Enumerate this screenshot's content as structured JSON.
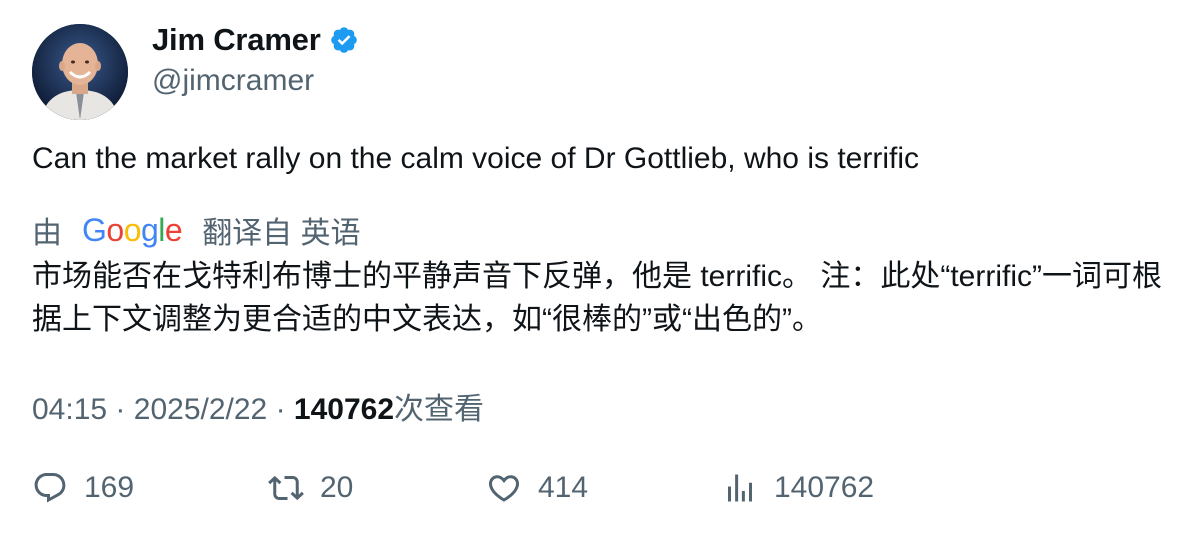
{
  "author": {
    "display_name": "Jim Cramer",
    "handle": "@jimcramer",
    "verified": true,
    "verified_color": "#1d9bf0"
  },
  "tweet": {
    "text": "Can the market rally on the calm voice of Dr Gottlieb, who is terrific"
  },
  "translation": {
    "prefix": "由",
    "provider": "Google",
    "label": "翻译自 英语",
    "text": "市场能否在戈特利布博士的平静声音下反弹，他是 terrific。 注：此处“terrific”一词可根据上下文调整为更合适的中文表达，如“很棒的”或“出色的”。"
  },
  "meta": {
    "time": "04:15",
    "separator": "·",
    "date": "2025/2/22",
    "views_count": "140762",
    "views_label": "次查看"
  },
  "actions": {
    "replies": "169",
    "retweets": "20",
    "likes": "414",
    "views": "140762"
  },
  "colors": {
    "text_primary": "#0f1419",
    "text_secondary": "#536471",
    "google_blue": "#4285F4",
    "google_red": "#EA4335",
    "google_yellow": "#FBBC05",
    "google_green": "#34A853"
  }
}
